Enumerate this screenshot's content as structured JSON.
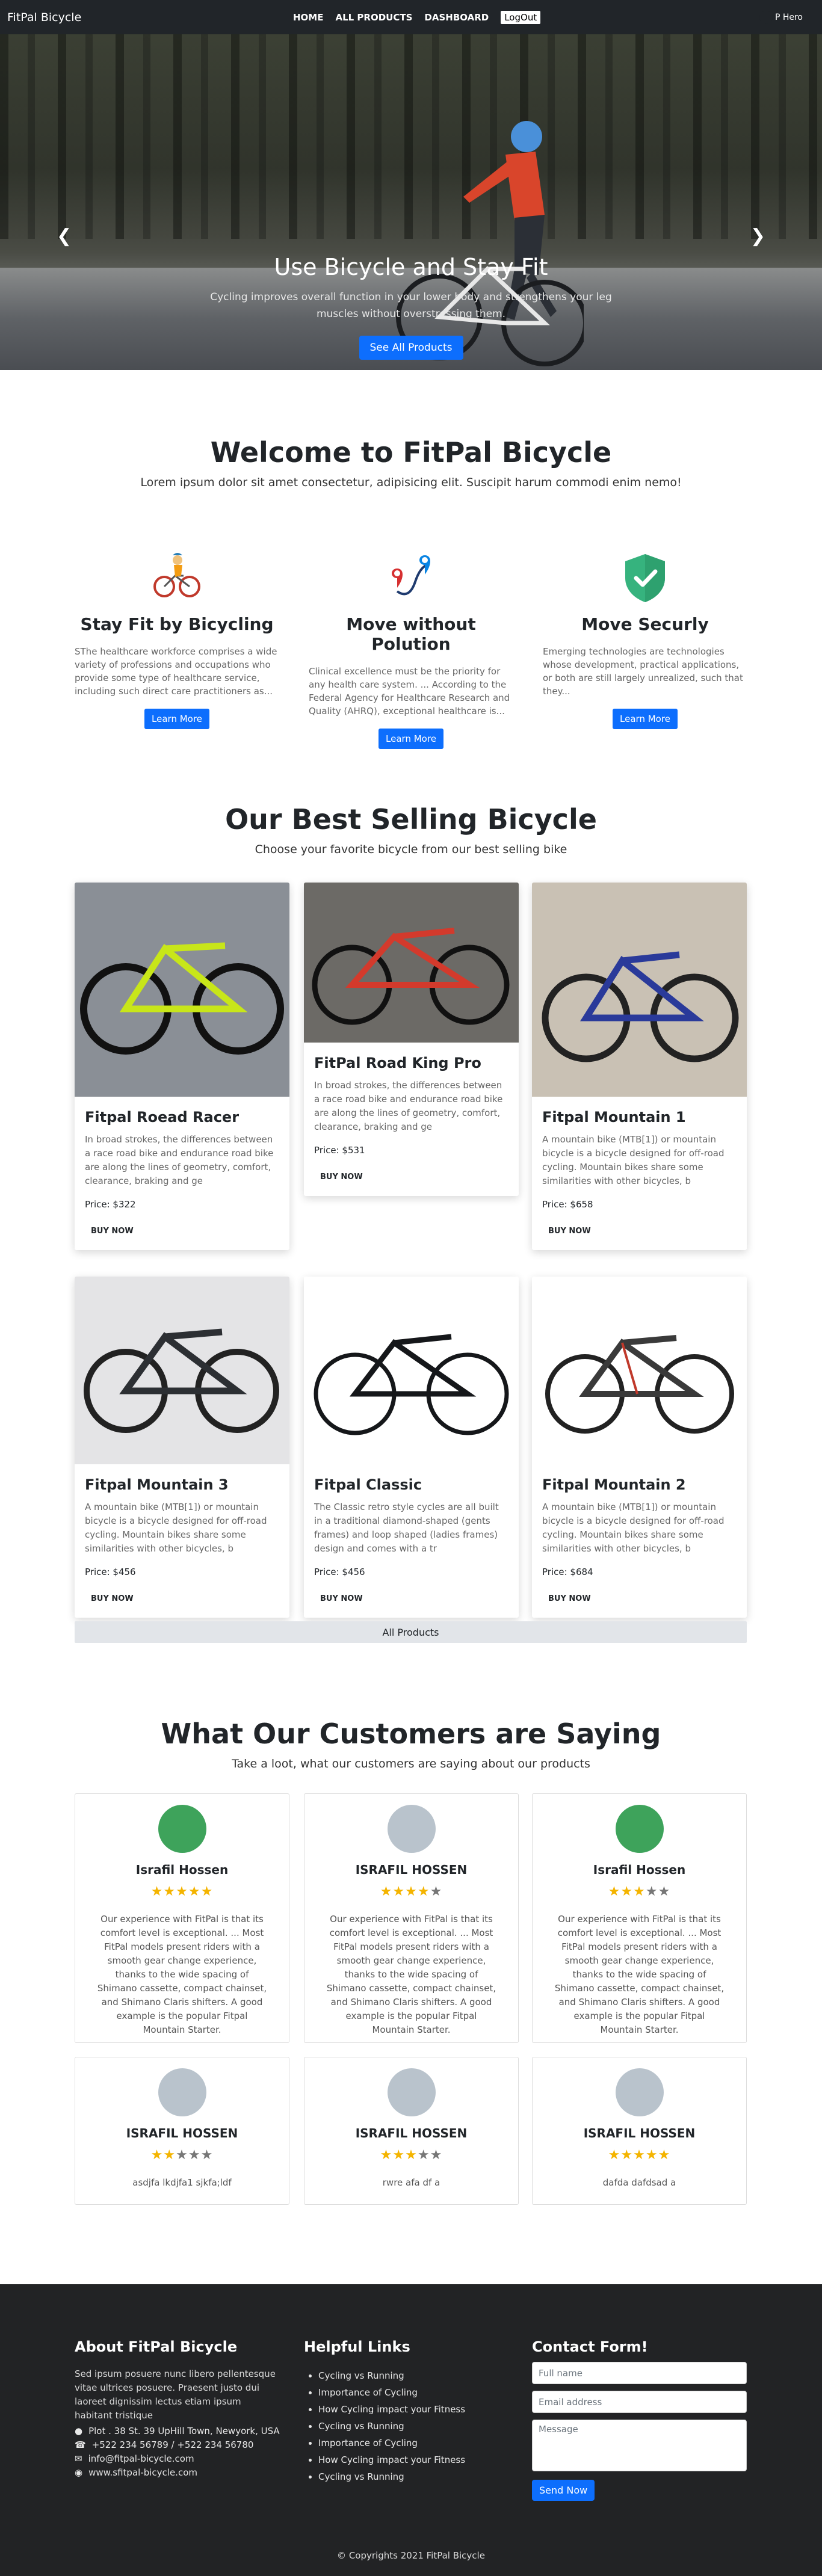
{
  "navbar": {
    "brand": "FitPal Bicycle",
    "links": [
      "HOME",
      "ALL PRODUCTS",
      "DASHBOARD"
    ],
    "logout": "LogOut",
    "user": "P Hero"
  },
  "hero": {
    "title": "Use Bicycle and Stay Fit",
    "text": "Cycling improves overall function in your lower body and strengthens your leg muscles without overstressing them.",
    "button": "See All Products"
  },
  "welcome": {
    "title": "Welcome to FitPal Bicycle",
    "subtitle": "Lorem ipsum dolor sit amet consectetur, adipisicing elit. Suscipit harum commodi enim nemo!",
    "features": [
      {
        "icon": "cyclist-icon",
        "title": "Stay Fit by Bicycling",
        "text": "SThe healthcare workforce comprises a wide variety of professions and occupations who provide some type of healthcare service, including such direct care practitioners as...",
        "button": "Learn More"
      },
      {
        "icon": "route-pin-icon",
        "title": "Move without Polution",
        "text": "Clinical excellence must be the priority for any health care system. ... According to the Federal Agency for Healthcare Research and Quality (AHRQ), exceptional healthcare is...",
        "button": "Learn More"
      },
      {
        "icon": "shield-check-icon",
        "title": "Move Securly",
        "text": "Emerging technologies are technologies whose development, practical applications, or both are still largely unrealized, such that they...",
        "button": "Learn More"
      }
    ]
  },
  "products": {
    "title": "Our Best Selling Bicycle",
    "subtitle": "Choose your favorite bicycle from our best selling bike",
    "buy_label": "BUY NOW",
    "all_button": "All Products",
    "items": [
      {
        "name": "Fitpal Roead Racer",
        "text": "In broad strokes, the differences between a race road bike and endurance road bike are along the lines of geometry, comfort, clearance, braking and ge",
        "price": "Price: $322",
        "frame": "#c8e619",
        "bg": "#8a8f96"
      },
      {
        "name": "FitPal Road King Pro",
        "text": "In broad strokes, the differences between a race road bike and endurance road bike are along the lines of geometry, comfort, clearance, braking and ge",
        "price": "Price: $531",
        "frame": "#d33a2c",
        "bg": "#6c6a66"
      },
      {
        "name": "Fitpal Mountain 1",
        "text": "A mountain bike (MTB[1]) or mountain bicycle is a bicycle designed for off-road cycling. Mountain bikes share some similarities with other bicycles, b",
        "price": "Price: $658",
        "frame": "#2a3a9a",
        "bg": "#c9c1b4"
      },
      {
        "name": "Fitpal Mountain 3",
        "text": "A mountain bike (MTB[1]) or mountain bicycle is a bicycle designed for off-road cycling. Mountain bikes share some similarities with other bicycles, b",
        "price": "Price: $456",
        "frame": "#2c2f33",
        "bg": "#e4e4e6"
      },
      {
        "name": "Fitpal Classic",
        "text": "The Classic retro style cycles are all built in a traditional diamond-shaped (gents frames) and loop shaped (ladies frames) design and comes with a tr",
        "price": "Price: $456",
        "frame": "#15171a",
        "bg": "#ffffff"
      },
      {
        "name": "Fitpal Mountain 2",
        "text": "A mountain bike (MTB[1]) or mountain bicycle is a bicycle designed for off-road cycling. Mountain bikes share some similarities with other bicycles, b",
        "price": "Price: $684",
        "frame": "#3a3a3a",
        "bg": "#ffffff"
      }
    ]
  },
  "reviews": {
    "title": "What Our Customers are Saying",
    "subtitle": "Take a loot, what our customers are saying about our products",
    "items": [
      {
        "name": "Israfil Hossen",
        "rating": 5,
        "text": "Our experience with FitPal is that its comfort level is exceptional. ... Most FitPal models present riders with a smooth gear change experience, thanks to the wide spacing of Shimano cassette, compact chainset, and Shimano Claris shifters. A good example is the popular Fitpal Mountain Starter.",
        "avatar_bg": "#3ea35b"
      },
      {
        "name": "ISRAFIL HOSSEN",
        "rating": 4,
        "text": "Our experience with FitPal is that its comfort level is exceptional. ... Most FitPal models present riders with a smooth gear change experience, thanks to the wide spacing of Shimano cassette, compact chainset, and Shimano Claris shifters. A good example is the popular Fitpal Mountain Starter.",
        "avatar_bg": "#b9c3cc"
      },
      {
        "name": "Israfil Hossen",
        "rating": 3,
        "text": "Our experience with FitPal is that its comfort level is exceptional. ... Most FitPal models present riders with a smooth gear change experience, thanks to the wide spacing of Shimano cassette, compact chainset, and Shimano Claris shifters. A good example is the popular Fitpal Mountain Starter.",
        "avatar_bg": "#3ea35b"
      },
      {
        "name": "ISRAFIL HOSSEN",
        "rating": 2,
        "text": "asdjfa lkdjfa1 sjkfa;ldf",
        "avatar_bg": "#b9c3cc"
      },
      {
        "name": "ISRAFIL HOSSEN",
        "rating": 3,
        "text": "rwre afa df a",
        "avatar_bg": "#b9c3cc"
      },
      {
        "name": "ISRAFIL HOSSEN",
        "rating": 5,
        "text": "dafda dafdsad a",
        "avatar_bg": "#b9c3cc"
      }
    ]
  },
  "footer": {
    "about_title": "About FitPal Bicycle",
    "about_text": "Sed ipsum posuere nunc libero pellentesque vitae ultrices posuere. Praesent justo dui laoreet dignissim lectus etiam ipsum habitant tristique",
    "contacts": [
      {
        "icon": "location-icon",
        "text": "Plot . 38 St. 39 UpHill Town, Newyork, USA"
      },
      {
        "icon": "phone-icon",
        "text": "+522 234 56789 / +522 234 56780"
      },
      {
        "icon": "envelope-icon",
        "text": "info@fitpal-bicycle.com"
      },
      {
        "icon": "globe-icon",
        "text": "www.sfitpal-bicycle.com"
      }
    ],
    "links_title": "Helpful Links",
    "links": [
      "Cycling vs Running",
      "Importance of Cycling",
      "How Cycling impact your Fitness",
      "Cycling vs Running",
      "Importance of Cycling",
      "How Cycling impact your Fitness",
      "Cycling vs Running"
    ],
    "form_title": "Contact Form!",
    "name_placeholder": "Full name",
    "email_placeholder": "Email address",
    "message_placeholder": "Message",
    "send": "Send Now",
    "copyright": "© Copyrights 2021 FitPal Bicycle"
  }
}
